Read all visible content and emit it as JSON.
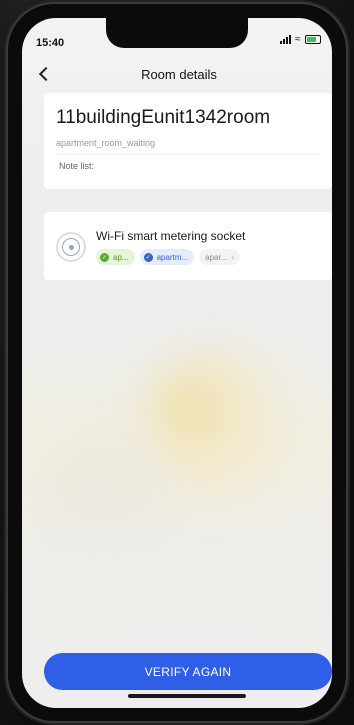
{
  "status_bar": {
    "time": "15:40"
  },
  "nav": {
    "title": "Room details"
  },
  "room": {
    "name": "11buildingEunit1342room",
    "status": "apartment_room_waiting",
    "note_label": "Note list:"
  },
  "device": {
    "name": "Wi-Fi smart metering socket",
    "tags": [
      {
        "label": "ap...",
        "color": "#5fa833"
      },
      {
        "label": "apartm...",
        "color": "#3a63c9"
      },
      {
        "label": "apar..."
      }
    ]
  },
  "actions": {
    "verify_label": "VERIFY  AGAIN"
  },
  "colors": {
    "accent": "#2f5fe6"
  }
}
